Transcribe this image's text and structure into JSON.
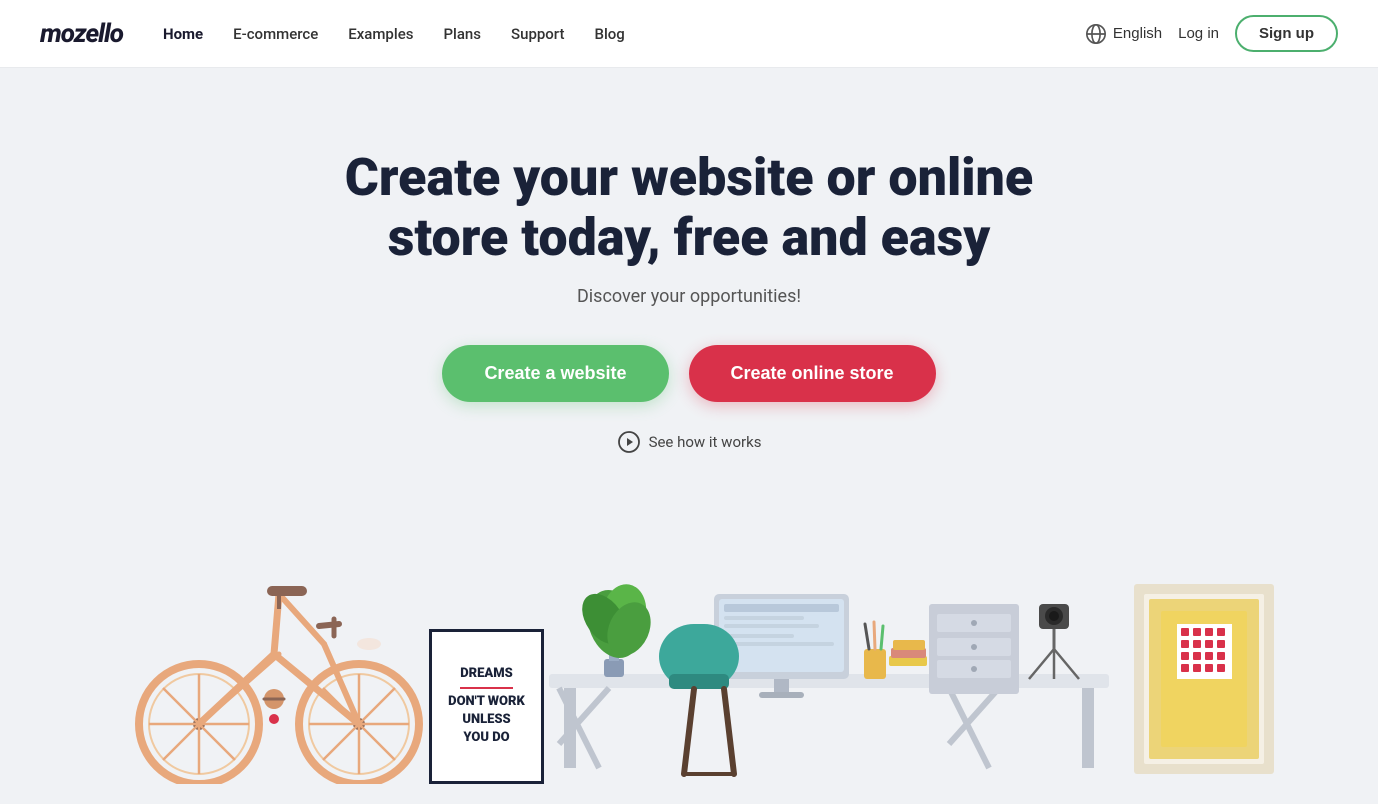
{
  "header": {
    "logo": "mozello",
    "nav": [
      {
        "label": "Home",
        "active": true,
        "id": "home"
      },
      {
        "label": "E-commerce",
        "active": false,
        "id": "ecommerce"
      },
      {
        "label": "Examples",
        "active": false,
        "id": "examples"
      },
      {
        "label": "Plans",
        "active": false,
        "id": "plans"
      },
      {
        "label": "Support",
        "active": false,
        "id": "support"
      },
      {
        "label": "Blog",
        "active": false,
        "id": "blog"
      }
    ],
    "lang": "English",
    "login": "Log in",
    "signup": "Sign up"
  },
  "hero": {
    "title": "Create your website or online store today, free and easy",
    "subtitle": "Discover your opportunities!",
    "btn_website": "Create a website",
    "btn_store": "Create online store",
    "see_how": "See how it works"
  },
  "poster": {
    "line1": "DREAMS",
    "line2": "DON'T WORK",
    "line3": "UNLESS",
    "line4": "YOU DO"
  }
}
